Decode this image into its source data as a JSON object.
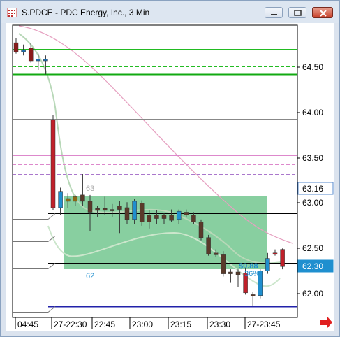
{
  "window": {
    "title": "S.PDCE - PDC Energy, Inc., 3 Min",
    "minimize_icon": "minimize-icon",
    "maximize_icon": "maximize-icon",
    "close_icon": "close-icon"
  },
  "chart_data": {
    "type": "candlestick",
    "y_axis_labels": [
      "64.50",
      "64.00",
      "63.50",
      "63.00",
      "62.50",
      "62.00"
    ],
    "x_axis_labels": [
      "04:45",
      "27-22:30",
      "22:45",
      "23:00",
      "23:15",
      "23:30",
      "27-23:45"
    ],
    "price_badges": [
      {
        "text": "63.16",
        "bg": "#ffffff",
        "fg": "#000000"
      },
      {
        "text": "62.30",
        "bg": "#1f8fcf",
        "fg": "#ffffff"
      }
    ],
    "annotations": [
      {
        "text": "63"
      },
      {
        "text": "62"
      },
      {
        "text": "$0.88"
      },
      {
        "text": "36%"
      }
    ],
    "candles": [
      {
        "o": 64.8,
        "h": 64.85,
        "l": 64.68,
        "c": 64.7,
        "color": "#8b1a1a"
      },
      {
        "o": 64.72,
        "h": 64.78,
        "l": 64.66,
        "c": 64.7,
        "color": "#1f6fb2"
      },
      {
        "o": 64.74,
        "h": 64.8,
        "l": 64.58,
        "c": 64.6,
        "color": "#8b1a1a"
      },
      {
        "o": 64.62,
        "h": 64.68,
        "l": 64.5,
        "c": 64.6,
        "color": "#1f6fb2"
      },
      {
        "o": 64.6,
        "h": 64.66,
        "l": 64.45,
        "c": 64.62,
        "color": "#1f6fb2"
      },
      {
        "o": 63.95,
        "h": 64.0,
        "l": 62.95,
        "c": 62.98,
        "color": "#c0202a"
      },
      {
        "o": 62.98,
        "h": 63.2,
        "l": 62.9,
        "c": 63.16,
        "color": "#1f8fcf"
      },
      {
        "o": 63.08,
        "h": 63.14,
        "l": 62.98,
        "c": 63.05,
        "color": "#8b6914"
      },
      {
        "o": 63.05,
        "h": 63.12,
        "l": 63.0,
        "c": 63.1,
        "color": "#8b6914"
      },
      {
        "o": 63.12,
        "h": 63.35,
        "l": 63.0,
        "c": 63.05,
        "color": "#5a3a2a"
      },
      {
        "o": 63.05,
        "h": 63.12,
        "l": 62.72,
        "c": 62.93,
        "color": "#5a3a2a"
      },
      {
        "o": 62.95,
        "h": 63.0,
        "l": 62.88,
        "c": 62.97,
        "color": "#5a3a2a"
      },
      {
        "o": 62.97,
        "h": 63.1,
        "l": 62.9,
        "c": 62.95,
        "color": "#5a3a2a"
      },
      {
        "o": 62.95,
        "h": 63.02,
        "l": 62.88,
        "c": 62.96,
        "color": "#5a3a2a"
      },
      {
        "o": 62.96,
        "h": 63.05,
        "l": 62.7,
        "c": 63.0,
        "color": "#5a3a2a"
      },
      {
        "o": 62.98,
        "h": 63.04,
        "l": 62.8,
        "c": 62.85,
        "color": "#5a3a2a"
      },
      {
        "o": 62.85,
        "h": 63.08,
        "l": 62.8,
        "c": 63.05,
        "color": "#1f8fcf"
      },
      {
        "o": 63.03,
        "h": 63.06,
        "l": 62.78,
        "c": 62.82,
        "color": "#5a3a2a"
      },
      {
        "o": 62.82,
        "h": 62.95,
        "l": 62.75,
        "c": 62.9,
        "color": "#5a3a2a"
      },
      {
        "o": 62.9,
        "h": 62.95,
        "l": 62.8,
        "c": 62.86,
        "color": "#5a3a2a"
      },
      {
        "o": 62.86,
        "h": 62.92,
        "l": 62.8,
        "c": 62.9,
        "color": "#5a3a2a"
      },
      {
        "o": 62.9,
        "h": 62.96,
        "l": 62.82,
        "c": 62.84,
        "color": "#5a3a2a"
      },
      {
        "o": 62.85,
        "h": 62.96,
        "l": 62.8,
        "c": 62.94,
        "color": "#1f8fcf"
      },
      {
        "o": 62.93,
        "h": 62.96,
        "l": 62.88,
        "c": 62.9,
        "color": "#5a3a2a"
      },
      {
        "o": 62.9,
        "h": 62.93,
        "l": 62.8,
        "c": 62.82,
        "color": "#5a3a2a"
      },
      {
        "o": 62.82,
        "h": 62.85,
        "l": 62.62,
        "c": 62.65,
        "color": "#5a3a2a"
      },
      {
        "o": 62.65,
        "h": 62.68,
        "l": 62.45,
        "c": 62.47,
        "color": "#5a3a2a"
      },
      {
        "o": 62.48,
        "h": 62.52,
        "l": 62.44,
        "c": 62.46,
        "color": "#5a3a2a"
      },
      {
        "o": 62.46,
        "h": 62.5,
        "l": 62.22,
        "c": 62.25,
        "color": "#5a3a2a"
      },
      {
        "o": 62.25,
        "h": 62.3,
        "l": 62.15,
        "c": 62.27,
        "color": "#5a3a2a"
      },
      {
        "o": 62.27,
        "h": 62.3,
        "l": 62.1,
        "c": 62.24,
        "color": "#5a3a2a"
      },
      {
        "o": 62.26,
        "h": 62.32,
        "l": 62.02,
        "c": 62.04,
        "color": "#c0202a"
      },
      {
        "o": 62.02,
        "h": 62.05,
        "l": 61.9,
        "c": 62.01,
        "color": "#5a3a2a"
      },
      {
        "o": 62.01,
        "h": 62.3,
        "l": 61.98,
        "c": 62.28,
        "color": "#1f8fcf"
      },
      {
        "o": 62.28,
        "h": 62.48,
        "l": 62.25,
        "c": 62.42,
        "color": "#1f8fcf"
      },
      {
        "o": 62.48,
        "h": 62.52,
        "l": 62.45,
        "c": 62.48,
        "color": "#c0202a"
      },
      {
        "o": 62.52,
        "h": 62.53,
        "l": 62.3,
        "c": 62.33,
        "color": "#c0202a"
      }
    ],
    "horizontal_lines": [
      {
        "price": 64.93,
        "color": "#000000",
        "dash": false
      },
      {
        "price": 64.73,
        "color": "#22bb22",
        "dash": false
      },
      {
        "price": 64.54,
        "color": "#22bb22",
        "dash": true
      },
      {
        "price": 64.45,
        "color": "#11aa11",
        "dash": false,
        "width": 2
      },
      {
        "price": 64.34,
        "color": "#22bb22",
        "dash": true
      },
      {
        "price": 63.96,
        "color": "#888888",
        "dash": false
      },
      {
        "price": 63.56,
        "color": "#dd88cc",
        "dash": false
      },
      {
        "price": 63.46,
        "color": "#dd88cc",
        "dash": true
      },
      {
        "price": 63.35,
        "color": "#aa77cc",
        "dash": true
      },
      {
        "price": 63.16,
        "color": "#5588cc",
        "dash": false
      },
      {
        "price": 62.92,
        "color": "#000000",
        "dash": false
      },
      {
        "price": 62.67,
        "color": "#cc2222",
        "dash": false
      },
      {
        "price": 62.37,
        "color": "#000000",
        "dash": false
      },
      {
        "price": 61.89,
        "color": "#2222aa",
        "dash": false,
        "width": 2
      }
    ],
    "box": {
      "color": "#55bb77"
    }
  }
}
